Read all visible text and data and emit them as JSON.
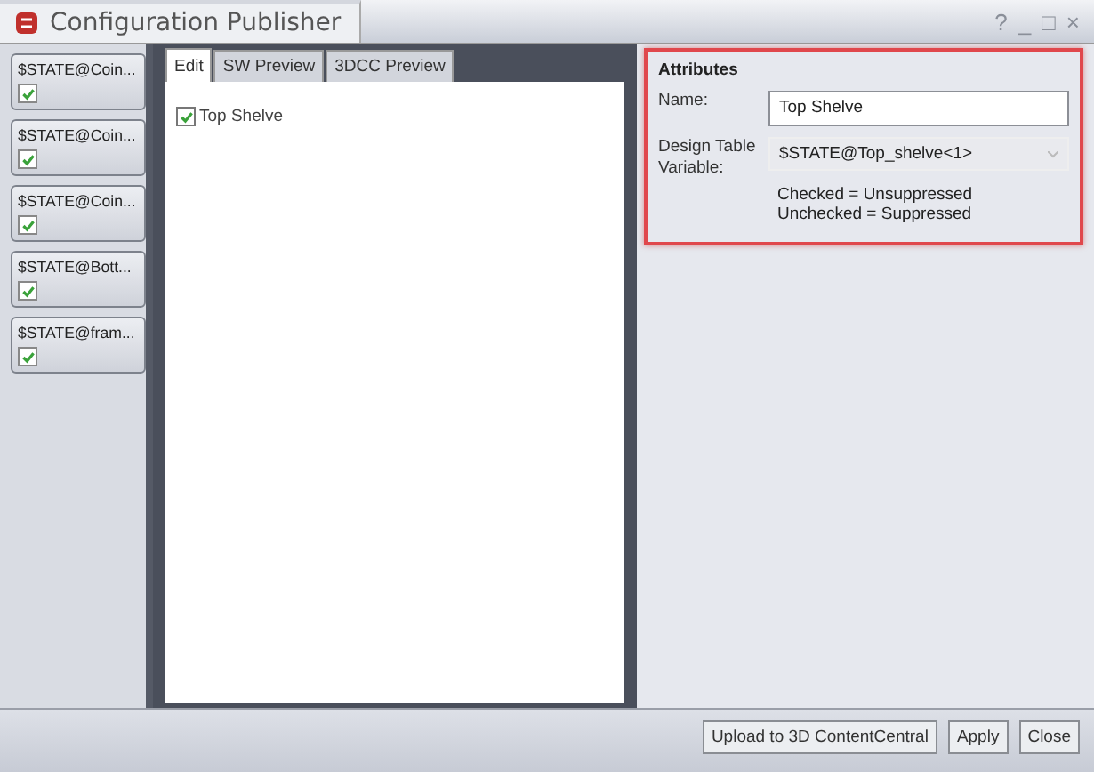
{
  "window": {
    "title": "Configuration Publisher",
    "controls": [
      "?",
      "_",
      "□",
      "×"
    ]
  },
  "configurations": [
    {
      "label": "$STATE@Coin...",
      "checked": true
    },
    {
      "label": "$STATE@Coin...",
      "checked": true
    },
    {
      "label": "$STATE@Coin...",
      "checked": true
    },
    {
      "label": "$STATE@Bott...",
      "checked": true
    },
    {
      "label": "$STATE@fram...",
      "checked": true
    }
  ],
  "tabs": [
    {
      "label": "Edit",
      "selected": true
    },
    {
      "label": "SW Preview",
      "selected": false
    },
    {
      "label": "3DCC Preview",
      "selected": false
    }
  ],
  "edit_items": [
    {
      "label": "Top Shelve",
      "checked": true
    }
  ],
  "attributes": {
    "title": "Attributes",
    "highlighted": true,
    "name_label": "Name:",
    "name_value": "Top Shelve",
    "variable_label": "Design Table Variable:",
    "variable_value": "$STATE@Top_shelve<1>",
    "variable_disabled": true,
    "notes": [
      "Checked = Unsuppressed",
      "Unchecked = Suppressed"
    ]
  },
  "buttons": [
    "Upload to 3D ContentCentral",
    "Apply",
    "Close"
  ]
}
